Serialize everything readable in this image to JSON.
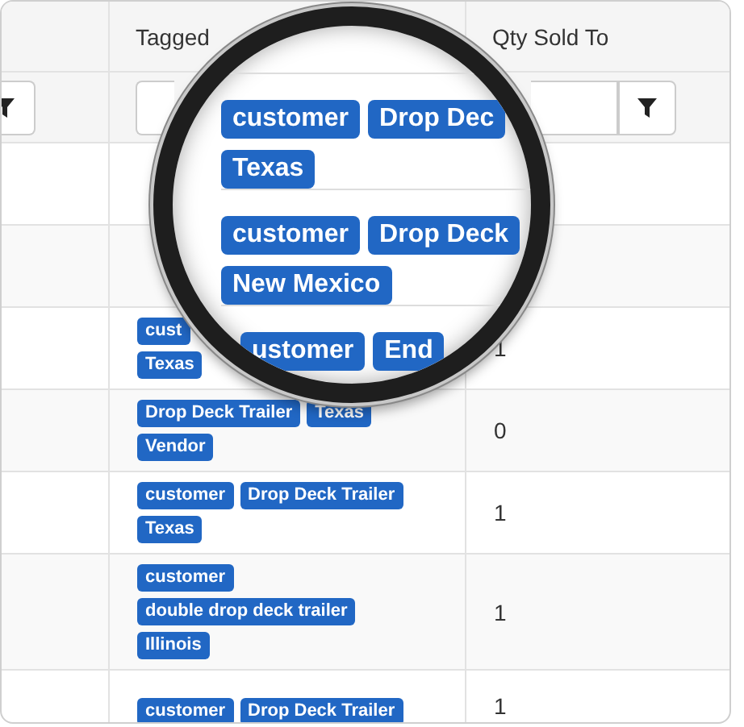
{
  "table": {
    "columns": [
      "Tagged",
      "Qty Sold To"
    ],
    "rows": [
      {
        "lines": [
          [
            "cust"
          ],
          [
            "Texas"
          ]
        ],
        "qty": "1"
      },
      {
        "lines": [
          [
            "Drop Deck Trailer",
            "Texas"
          ],
          [
            "Vendor"
          ]
        ],
        "qty": "0"
      },
      {
        "lines": [
          [
            "customer",
            "Drop Deck Trailer"
          ],
          [
            "Texas"
          ]
        ],
        "qty": "1"
      },
      {
        "lines": [
          [
            "customer"
          ],
          [
            "double drop deck trailer"
          ],
          [
            "Illinois"
          ]
        ],
        "qty": "1"
      },
      {
        "lines": [
          [
            "customer",
            "Drop Deck Trailer"
          ]
        ],
        "qty": "1"
      }
    ]
  },
  "magnifier": {
    "rows": [
      {
        "lines": [
          [
            "customer",
            "Drop Dec"
          ],
          [
            "Texas"
          ]
        ]
      },
      {
        "lines": [
          [
            "customer",
            "Drop Deck"
          ],
          [
            "New Mexico"
          ]
        ]
      },
      {
        "lines": [
          [
            "ustomer",
            "End"
          ]
        ]
      }
    ]
  }
}
